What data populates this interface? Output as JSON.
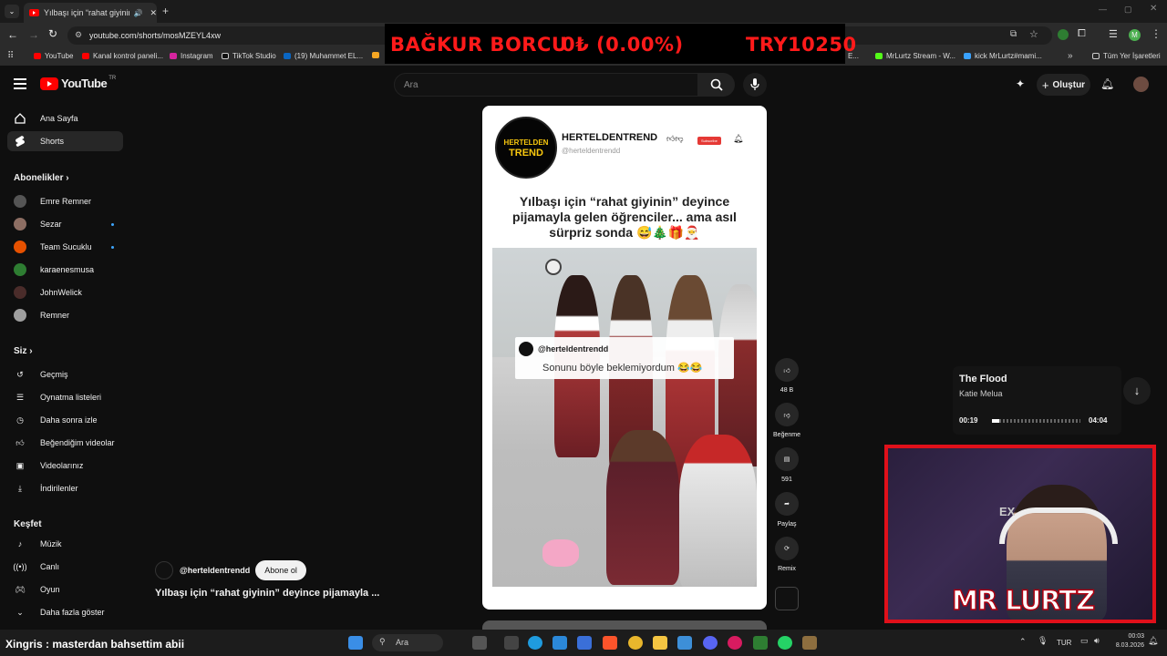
{
  "browser": {
    "tab_title": "Yılbaşı için “rahat giyinin” d",
    "url": "youtube.com/shorts/mosMZEYL4xw",
    "bookmarks": [
      "YouTube",
      "Kanal kontrol paneli...",
      "Instagram",
      "TikTok Studio",
      "(19) Muhammet EL...",
      "MrLurtz Stream - W...",
      "kick MrLurtz#mami...",
      "Tüm Yer İşaretleri"
    ],
    "bookmark_partial": "E..."
  },
  "overlay": {
    "label": "BAĞKUR BORCU",
    "change": "0₺ (0.00%)",
    "amount": "TRY10250"
  },
  "youtube": {
    "logo_text": "YouTube",
    "logo_region": "TR",
    "search_placeholder": "Ara",
    "create_label": "Oluştur"
  },
  "sidebar": {
    "home": "Ana Sayfa",
    "shorts": "Shorts",
    "subscriptions_header": "Abonelikler",
    "subscriptions": [
      "Emre Remner",
      "Sezar",
      "Team Sucuklu",
      "karaenesmusa",
      "JohnWelick",
      "Remner"
    ],
    "you_header": "Siz",
    "you_items": [
      "Geçmiş",
      "Oynatma listeleri",
      "Daha sonra izle",
      "Beğendiğim videolar",
      "Videolarınız",
      "İndirilenler"
    ],
    "explore_header": "Keşfet",
    "explore_items": [
      "Müzik",
      "Canlı",
      "Oyun",
      "Daha fazla göster"
    ]
  },
  "video": {
    "card_channel": "HERTELDENTREND",
    "card_handle": "@herteldentrendd",
    "logo_line1": "HERTELDEN",
    "logo_line2": "TREND",
    "subscribe_mini": "Subscribe",
    "caption": "Yılbaşı için “rahat giyinin” deyince pijamayla gelen öğrenciler... ama asıl sürpriz sonda 😅🎄🎁🎅",
    "comment_user": "@herteldentrendd",
    "comment_text": "Sonunu böyle beklemiyordum 😂😂",
    "channel_handle": "@herteldentrendd",
    "subscribe_label": "Abone ol",
    "title": "Yılbaşı için “rahat giyinin” deyince pijamayla ..."
  },
  "actions": {
    "likes": "48 B",
    "dislike": "Beğenme",
    "comments": "591",
    "share": "Paylaş",
    "remix": "Remix"
  },
  "music": {
    "title": "The Flood",
    "artist": "Katie Melua",
    "elapsed": "00:19",
    "total": "04:04",
    "progress": 0.08
  },
  "webcam": {
    "name": "MR LURTZ",
    "ex": "EX"
  },
  "chat": {
    "line": "Xingris : masterdan bahsettim abii"
  },
  "taskbar": {
    "search": "Ara",
    "lang": "TUR",
    "time": "00:03",
    "date": "8.03.2026"
  },
  "colors": {
    "youtube_red": "#ff0000",
    "overlay_red": "#ff1a1a",
    "webcam_border": "#e0101a"
  }
}
